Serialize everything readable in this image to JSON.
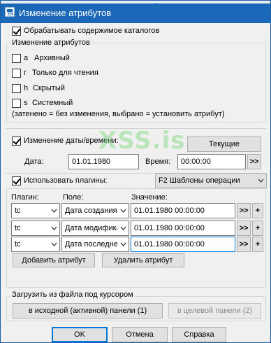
{
  "window": {
    "title": "Изменение атрибутов",
    "app_icon_text": "EN"
  },
  "process_dirs": {
    "label": "Обрабатывать содержимое каталогов",
    "checked": true
  },
  "attributes": {
    "group_title": "Изменение атрибутов",
    "items": [
      {
        "letter": "a",
        "label": "Архивный",
        "checked": false
      },
      {
        "letter": "r",
        "label": "Только для чтения",
        "checked": false
      },
      {
        "letter": "h",
        "label": "Скрытый",
        "checked": false
      },
      {
        "letter": "s",
        "label": "Системный",
        "checked": false
      }
    ],
    "hint": "(затенено = без изменения, выбрано = установить атрибут)"
  },
  "datetime": {
    "checkbox_label": "Изменение даты/времени:",
    "checked": true,
    "current_button": "Текущие",
    "date_label": "Дата:",
    "date_value": "01.01.1980",
    "time_label": "Время:",
    "time_value": "00:00:00",
    "time_more_button": ">>"
  },
  "plugins": {
    "checkbox_label": "Использовать плагины:",
    "checked": true,
    "template_combo": "F2 Шаблоны операции",
    "col_plugin": "Плагин:",
    "col_field": "Поле:",
    "col_value": "Значение:",
    "rows": [
      {
        "plugin": "tc",
        "field": "Дата создания",
        "value": "01.01.1980 00:00:00"
      },
      {
        "plugin": "tc",
        "field": "Дата модификации",
        "value": "01.01.1980 00:00:00"
      },
      {
        "plugin": "tc",
        "field": "Дата последнего доступа",
        "value": "01.01.1980 00:00:00"
      }
    ],
    "more_button": ">>",
    "plus_button": "+",
    "add_attribute": "Добавить атрибут",
    "remove_attribute": "Удалить атрибут"
  },
  "load_from_file": {
    "title": "Загрузить из файла под курсором",
    "source_button": "в исходной (активной) панели (1)",
    "target_button": "в целевой панели (2)"
  },
  "footer": {
    "ok": "OK",
    "cancel": "Отмена",
    "help": "Справка"
  },
  "watermark": "XSS.is",
  "titlebar_ghost": "...",
  "colors": {
    "titlebar": "#1c68b8",
    "focus_border": "#0078d7",
    "watermark": "#78d778"
  }
}
